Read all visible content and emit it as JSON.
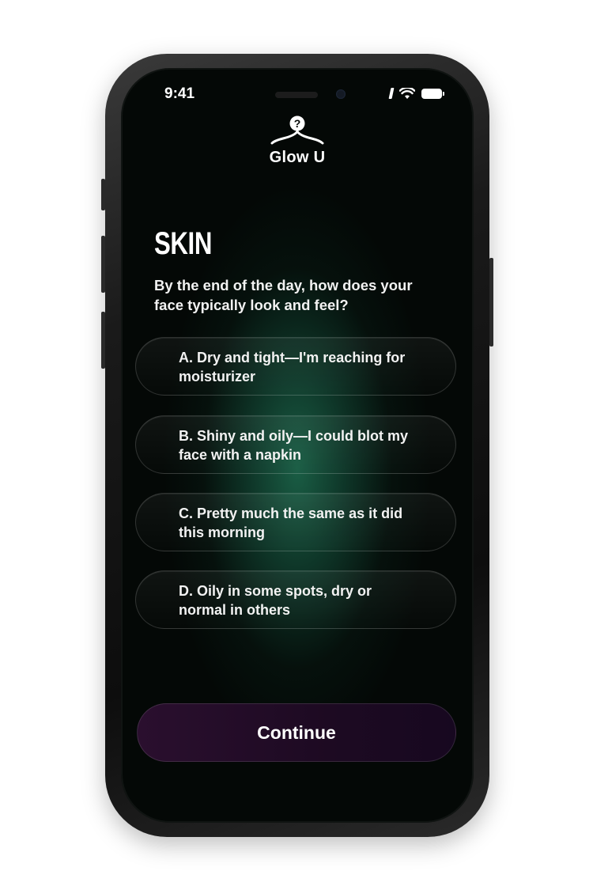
{
  "status_bar": {
    "time": "9:41",
    "icons": [
      "signal-icon",
      "wifi-icon",
      "battery-icon"
    ]
  },
  "brand": {
    "name": "Glow U",
    "logo_icon": "hanger-question-icon"
  },
  "quiz": {
    "section": "SKIN",
    "question": "By the end of the day, how does your face typically look and feel?",
    "options": [
      {
        "label": "A. Dry and tight—I'm reaching for moisturizer"
      },
      {
        "label": "B. Shiny and oily—I could blot my face with a napkin"
      },
      {
        "label": "C. Pretty much the same as it did this morning"
      },
      {
        "label": "D. Oily in some spots, dry or normal in others"
      }
    ]
  },
  "actions": {
    "continue_label": "Continue"
  },
  "colors": {
    "background": "#040806",
    "glow": "#1b6248",
    "button": "#2a0f2e",
    "text": "#ffffff"
  }
}
